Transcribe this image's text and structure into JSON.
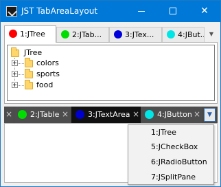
{
  "window": {
    "title": "JST TabAreaLayout",
    "minimize_symbol": "",
    "maximize_symbol": "",
    "close_symbol": "✕"
  },
  "top_tabs": {
    "tabs": [
      {
        "label": "1:JTree",
        "color": "#ff0000"
      },
      {
        "label": "2:JTab...",
        "color": "#00dd00"
      },
      {
        "label": "3:JTex...",
        "color": "#0000dd"
      },
      {
        "label": "4:JBut...",
        "color": "#00e5e5"
      }
    ],
    "menu_symbol": "▼"
  },
  "tree": {
    "root": "JTree",
    "children": [
      "colors",
      "sports",
      "food"
    ]
  },
  "bottom_tabs": {
    "close_symbol": "×",
    "tabs": [
      {
        "label": "2:JTable",
        "color": "#00dd00"
      },
      {
        "label": "3:JTextArea",
        "color": "#0000cc"
      },
      {
        "label": "4:JButton",
        "color": "#00e5e5"
      }
    ],
    "dropdown_symbol": "▼"
  },
  "popup_menu": {
    "items": [
      "1:JTree",
      "5:JCheckBox",
      "6:JRadioButton",
      "7:JSplitPane"
    ]
  }
}
